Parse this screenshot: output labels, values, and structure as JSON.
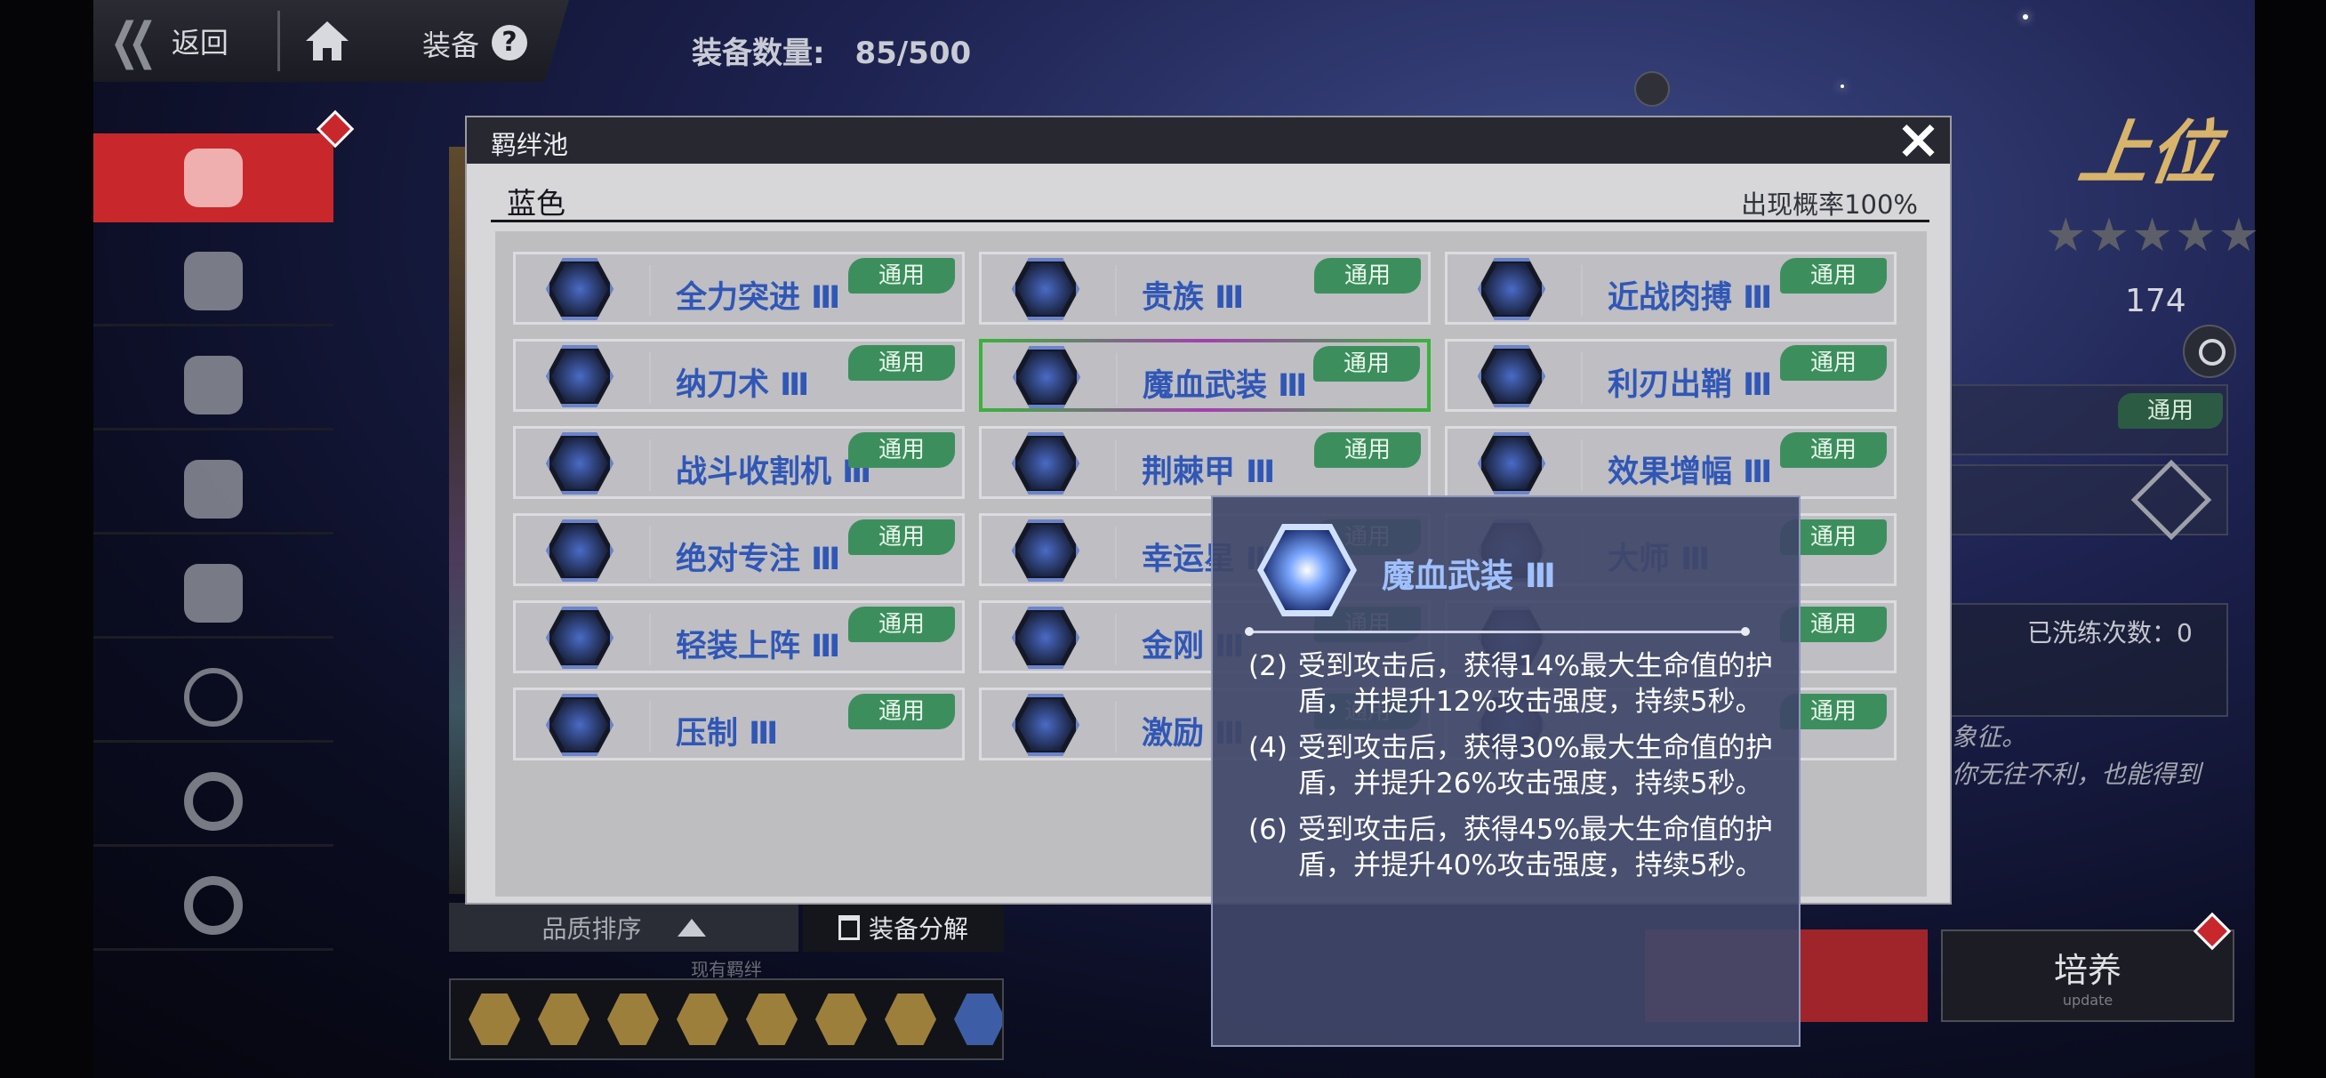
{
  "header": {
    "back_label": "返回",
    "breadcrumb": "装备",
    "help_symbol": "?",
    "count_label": "装备数量:",
    "count_value": "85/500"
  },
  "sidebar": {
    "items": [
      {
        "name": "helmet",
        "active": true
      },
      {
        "name": "armor",
        "active": false
      },
      {
        "name": "pants",
        "active": false
      },
      {
        "name": "gloves",
        "active": false
      },
      {
        "name": "boots",
        "active": false
      },
      {
        "name": "necklace",
        "active": false
      },
      {
        "name": "ring-1",
        "active": false
      },
      {
        "name": "ring-2",
        "active": false
      }
    ]
  },
  "background_panel": {
    "sort_label": "品质排序",
    "dismantle_label": "装备分解",
    "current_bonds_label": "现有羁绊",
    "rank_title": "上位",
    "stars": "★★★★★",
    "stat_value": "174",
    "tag": "通用",
    "refine_count": "已洗练次数：0",
    "desc_line1": "象征。",
    "desc_line2": "你无往不利，也能得到",
    "cultivate_label": "培养",
    "cultivate_sub": "update"
  },
  "dialog": {
    "title": "羁绊池",
    "grade": "蓝色",
    "rate": "出现概率100%",
    "tag_label": "通用",
    "bonds": [
      {
        "name": "全力突进 Ⅲ",
        "row": 0,
        "col": 0
      },
      {
        "name": "贵族 Ⅲ",
        "row": 0,
        "col": 1
      },
      {
        "name": "近战肉搏 Ⅲ",
        "row": 0,
        "col": 2
      },
      {
        "name": "纳刀术 Ⅲ",
        "row": 1,
        "col": 0
      },
      {
        "name": "魔血武装 Ⅲ",
        "row": 1,
        "col": 1,
        "selected": true
      },
      {
        "name": "利刃出鞘 Ⅲ",
        "row": 1,
        "col": 2
      },
      {
        "name": "战斗收割机 Ⅲ",
        "row": 2,
        "col": 0
      },
      {
        "name": "荆棘甲 Ⅲ",
        "row": 2,
        "col": 1
      },
      {
        "name": "效果增幅 Ⅲ",
        "row": 2,
        "col": 2
      },
      {
        "name": "绝对专注 Ⅲ",
        "row": 3,
        "col": 0
      },
      {
        "name": "幸运星 Ⅲ",
        "row": 3,
        "col": 1
      },
      {
        "name": "大师 Ⅲ",
        "row": 3,
        "col": 2
      },
      {
        "name": "轻装上阵 Ⅲ",
        "row": 4,
        "col": 0
      },
      {
        "name": "金刚 Ⅲ",
        "row": 4,
        "col": 1
      },
      {
        "name": "",
        "row": 4,
        "col": 2
      },
      {
        "name": "压制 Ⅲ",
        "row": 5,
        "col": 0
      },
      {
        "name": "激励 Ⅲ",
        "row": 5,
        "col": 1
      },
      {
        "name": "",
        "row": 5,
        "col": 2
      }
    ]
  },
  "tooltip": {
    "title": "魔血武装 Ⅲ",
    "effects": [
      {
        "n": "(2)",
        "text": "受到攻击后，获得14%最大生命值的护盾，并提升12%攻击强度，持续5秒。"
      },
      {
        "n": "(4)",
        "text": "受到攻击后，获得30%最大生命值的护盾，并提升26%攻击强度，持续5秒。"
      },
      {
        "n": "(6)",
        "text": "受到攻击后，获得45%最大生命值的护盾，并提升40%攻击强度，持续5秒。"
      }
    ]
  }
}
